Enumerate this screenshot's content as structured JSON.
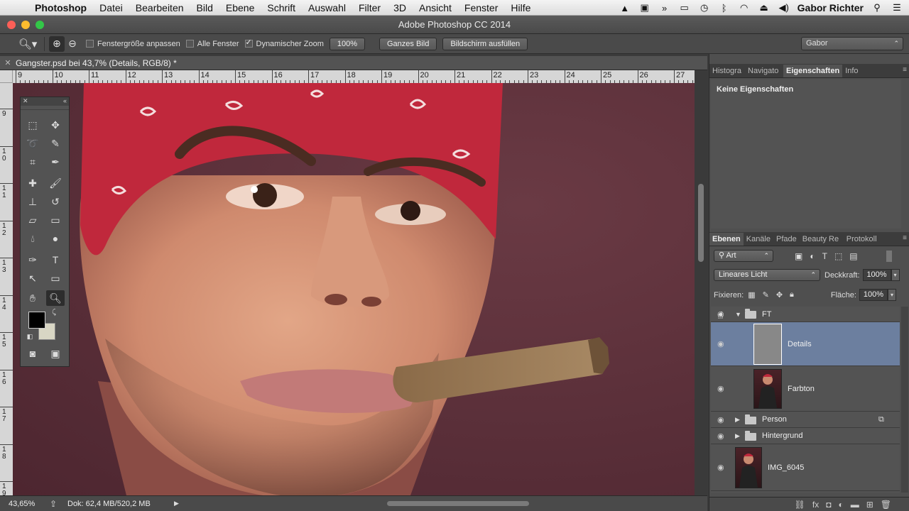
{
  "menubar": {
    "items": [
      "Photoshop",
      "Datei",
      "Bearbeiten",
      "Bild",
      "Ebene",
      "Schrift",
      "Auswahl",
      "Filter",
      "3D",
      "Ansicht",
      "Fenster",
      "Hilfe"
    ],
    "user": "Gabor Richter",
    "status_icons": [
      "hat-icon",
      "display-icon",
      "forward-icon",
      "airplay-icon",
      "time-machine-icon",
      "bluetooth-icon",
      "wifi-icon",
      "eject-icon",
      "volume-icon",
      "spotlight-icon",
      "list-icon"
    ]
  },
  "window": {
    "title": "Adobe Photoshop CC 2014"
  },
  "options": {
    "fit_window_label": "Fenstergröße anpassen",
    "all_windows_label": "Alle Fenster",
    "dynamic_zoom_label": "Dynamischer Zoom",
    "zoom_100_label": "100%",
    "whole_image_label": "Ganzes Bild",
    "fill_screen_label": "Bildschirm ausfüllen",
    "fit_window_checked": false,
    "all_windows_checked": false,
    "dynamic_zoom_checked": true,
    "workspace": "Gabor"
  },
  "document": {
    "tab_title": "Gangster.psd bei 43,7% (Details, RGB/8) *",
    "ruler_top": [
      "9",
      "10",
      "11",
      "12",
      "13",
      "14",
      "15",
      "16",
      "17",
      "18",
      "19",
      "20",
      "21",
      "22",
      "23",
      "24",
      "25",
      "26",
      "27"
    ],
    "ruler_left": [
      "9",
      "1 0",
      "1 1",
      "1 2",
      "1 3",
      "1 4",
      "1 5",
      "1 6",
      "1 7",
      "1 8",
      "1 9"
    ]
  },
  "status": {
    "zoom": "43,65%",
    "doc_info": "Dok: 62,4 MB/520,2 MB"
  },
  "properties": {
    "tabs": [
      "Histogra",
      "Navigato",
      "Eigenschaften",
      "Info"
    ],
    "active_tab": "Eigenschaften",
    "empty_text": "Keine Eigenschaften"
  },
  "layers": {
    "tabs": [
      "Ebenen",
      "Kanäle",
      "Pfade",
      "Beauty Re",
      "Protokoll"
    ],
    "filter_label": "Art",
    "blend_mode": "Lineares Licht",
    "opacity_label": "Deckkraft:",
    "opacity_value": "100%",
    "lock_label": "Fixieren:",
    "fill_label": "Fläche:",
    "fill_value": "100%",
    "items": [
      {
        "name": "FT",
        "kind": "group",
        "expanded": true
      },
      {
        "name": "Details",
        "kind": "layer",
        "selected": true
      },
      {
        "name": "Farbton",
        "kind": "layer"
      },
      {
        "name": "Person",
        "kind": "group",
        "expanded": false
      },
      {
        "name": "Hintergrund",
        "kind": "group",
        "expanded": false
      },
      {
        "name": "IMG_6045",
        "kind": "layer"
      }
    ]
  },
  "colors": {
    "foreground": "#000000",
    "background": "#d8d6c4",
    "selection": "#6c7f9f",
    "bandana": "#c0283c",
    "backdrop": "#5a2f39"
  }
}
